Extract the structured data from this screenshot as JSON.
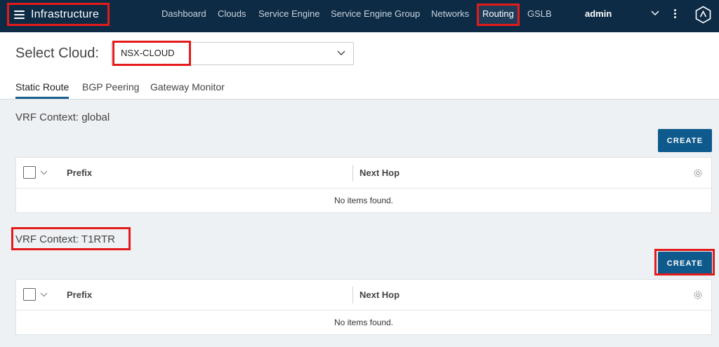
{
  "header": {
    "app_title": "Infrastructure",
    "nav": [
      "Dashboard",
      "Clouds",
      "Service Engine",
      "Service Engine Group",
      "Networks",
      "Routing",
      "GSLB"
    ],
    "active_nav": "Routing",
    "user": "admin",
    "icons": {
      "menu": "hamburger-icon",
      "user_menu": "chevron-down-icon",
      "more": "kebab-icon",
      "logo": "avi-logo-icon"
    }
  },
  "cloud_selector": {
    "label": "Select Cloud:",
    "value": "NSX-CLOUD"
  },
  "tabs": [
    "Static Route",
    "BGP Peering",
    "Gateway Monitor"
  ],
  "active_tab": "Static Route",
  "vrf_sections": [
    {
      "title": "VRF Context: global",
      "create_label": "CREATE",
      "columns": [
        "Prefix",
        "Next Hop"
      ],
      "empty_message": "No items found."
    },
    {
      "title": "VRF Context: T1RTR",
      "create_label": "CREATE",
      "columns": [
        "Prefix",
        "Next Hop"
      ],
      "empty_message": "No items found."
    }
  ],
  "colors": {
    "topbar": "#0d2b45",
    "accent": "#0f5a8c",
    "annotation": "#e41b1b"
  }
}
